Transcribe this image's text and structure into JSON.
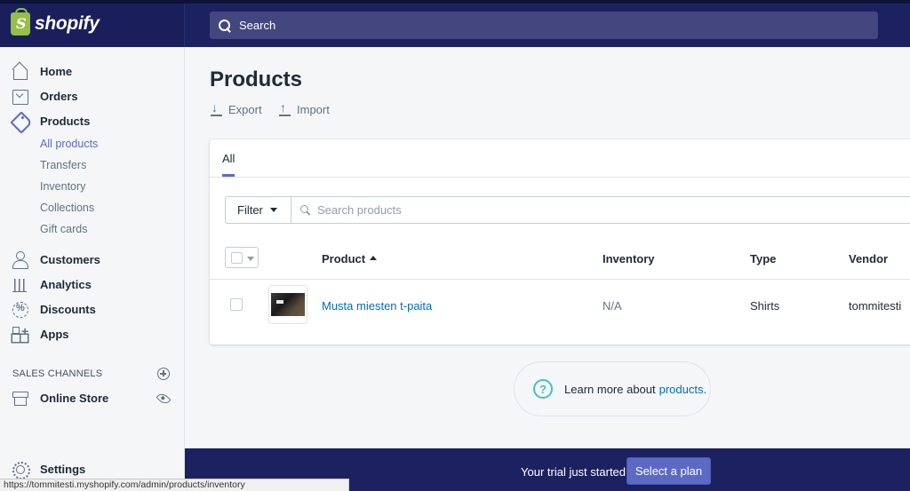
{
  "brand": {
    "name": "shopify",
    "bag_letter": "S"
  },
  "topbar": {
    "search_placeholder": "Search"
  },
  "sidebar": {
    "nav": [
      {
        "label": "Home",
        "icon": "home-icon"
      },
      {
        "label": "Orders",
        "icon": "orders-icon"
      },
      {
        "label": "Products",
        "icon": "tag-icon"
      },
      {
        "label": "Customers",
        "icon": "customers-icon"
      },
      {
        "label": "Analytics",
        "icon": "analytics-icon"
      },
      {
        "label": "Discounts",
        "icon": "discounts-icon"
      },
      {
        "label": "Apps",
        "icon": "apps-icon"
      }
    ],
    "product_sub": [
      "All products",
      "Transfers",
      "Inventory",
      "Collections",
      "Gift cards"
    ],
    "sales_channels_label": "SALES CHANNELS",
    "online_store": "Online Store",
    "settings": "Settings"
  },
  "main": {
    "title": "Products",
    "export_label": "Export",
    "import_label": "Import",
    "tab_all": "All",
    "filter_label": "Filter",
    "search_placeholder": "Search products",
    "columns": {
      "product": "Product",
      "inventory": "Inventory",
      "type": "Type",
      "vendor": "Vendor"
    },
    "rows": [
      {
        "product": "Musta miesten t-paita",
        "inventory": "N/A",
        "type": "Shirts",
        "vendor": "tommitesti"
      }
    ],
    "learn_more_text": "Learn more about",
    "learn_more_link": "products."
  },
  "trial": {
    "text": "Your trial just started",
    "button": "Select a plan"
  },
  "status_url": "https://tommitesti.myshopify.com/admin/products/inventory",
  "colors": {
    "nav_dark": "#1c2260",
    "accent": "#5c6ac4",
    "link": "#006fbb",
    "shopify_green": "#95bf47",
    "help_teal": "#47c1bf"
  }
}
